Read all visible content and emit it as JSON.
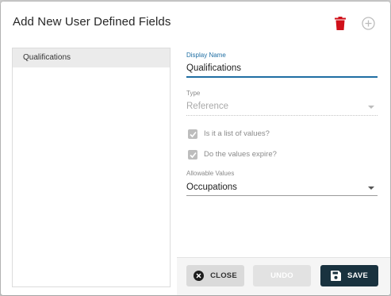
{
  "dialog": {
    "title": "Add New User Defined Fields",
    "icons": {
      "delete": "trash-icon",
      "add": "add-circle-icon"
    }
  },
  "sidebar": {
    "items": [
      {
        "label": "Qualifications",
        "selected": true
      }
    ]
  },
  "form": {
    "display_name": {
      "label": "Display Name",
      "value": "Qualifications"
    },
    "type": {
      "label": "Type",
      "value": "Reference",
      "disabled": true
    },
    "is_list": {
      "label": "Is it a list of values?",
      "checked": true,
      "disabled": true
    },
    "expire": {
      "label": "Do the values expire?",
      "checked": true,
      "disabled": true
    },
    "allowable_values": {
      "label": "Allowable Values",
      "value": "Occupations"
    }
  },
  "footer": {
    "close_label": "CLOSE",
    "undo_label": "UNDO",
    "save_label": "SAVE"
  },
  "colors": {
    "accent": "#1f6ea3",
    "delete_red": "#d0101a",
    "save_bg": "#19323f"
  }
}
